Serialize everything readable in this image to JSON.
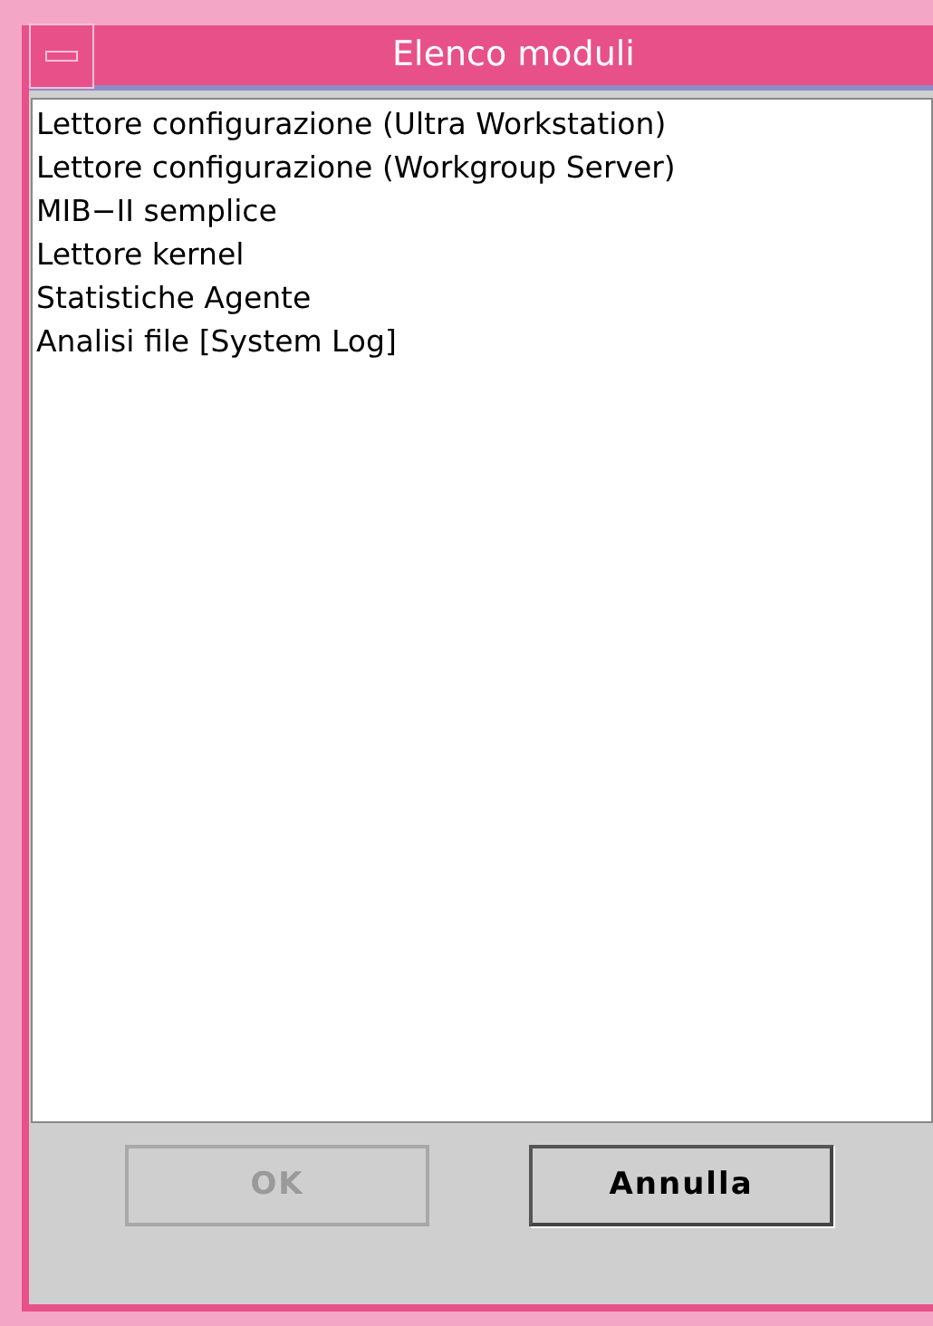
{
  "window": {
    "title": "Elenco moduli"
  },
  "modules": [
    "Lettore configurazione (Ultra Workstation)",
    "Lettore configurazione (Workgroup Server)",
    "MIB−II semplice",
    "Lettore kernel",
    "Statistiche Agente",
    "Analisi file [System Log]"
  ],
  "buttons": [
    {
      "label": "OK",
      "disabled": true
    },
    {
      "label": "Annulla",
      "disabled": false
    }
  ]
}
